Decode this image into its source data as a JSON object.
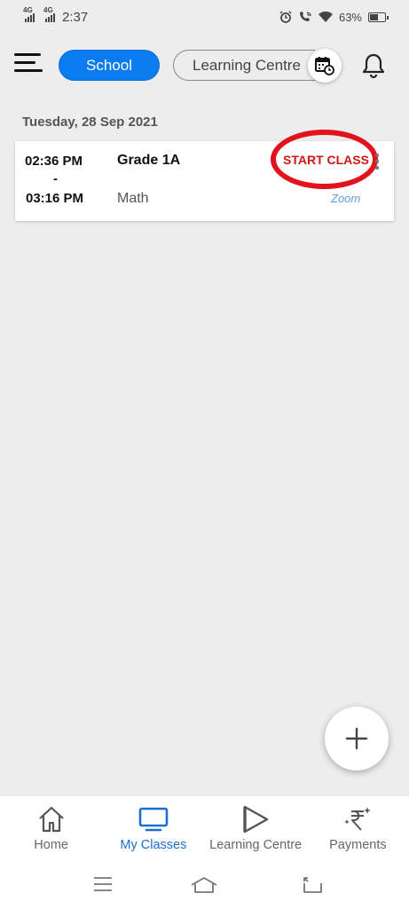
{
  "status_bar": {
    "network_1": "4G",
    "network_2": "4G",
    "time": "2:37",
    "battery_percent": "63%",
    "battery_level": 0.63,
    "icons": [
      "alarm-icon",
      "wifi-call-icon",
      "wifi-icon",
      "battery-icon"
    ]
  },
  "header": {
    "tabs": [
      {
        "label": "School",
        "active": true
      },
      {
        "label": "Learning Centre",
        "active": false
      }
    ],
    "icons": [
      "menu-icon",
      "calendar-clock-icon",
      "bell-icon"
    ]
  },
  "schedule": {
    "date": "Tuesday, 28 Sep 2021",
    "classes": [
      {
        "start_time": "02:36 PM",
        "separator": "-",
        "end_time": "03:16 PM",
        "grade": "Grade 1A",
        "subject": "Math",
        "action_label": "START CLASS",
        "platform": "Zoom"
      }
    ]
  },
  "fab": {
    "icon": "plus-icon"
  },
  "bottom_nav": {
    "items": [
      {
        "label": "Home",
        "icon": "home-icon",
        "active": false
      },
      {
        "label": "My Classes",
        "icon": "monitor-icon",
        "active": true
      },
      {
        "label": "Learning Centre",
        "icon": "play-triangle-icon",
        "active": false
      },
      {
        "label": "Payments",
        "icon": "rupee-sparkle-icon",
        "active": false
      }
    ]
  },
  "system_nav": {
    "icons": [
      "recents-icon",
      "home-outline-icon",
      "back-icon"
    ]
  },
  "colors": {
    "accent": "#0a7cf0",
    "start_class": "#d21414",
    "highlight": "#e2131c",
    "active_nav": "#1a6fd0",
    "background": "#ededed"
  }
}
